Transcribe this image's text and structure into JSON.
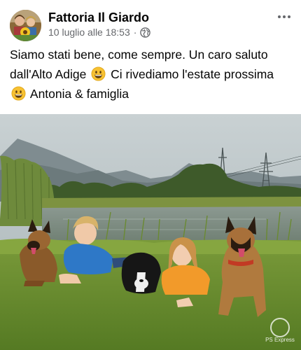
{
  "post": {
    "page_name": "Fattoria Il Giardo",
    "timestamp": "10 luglio alle 18:53",
    "separator": "·",
    "audience_icon": "globe-icon",
    "more_icon": "more-dots-icon",
    "text": {
      "line1": "Siamo stati bene, come sempre. Un caro saluto",
      "line2a": "dall'Alto Adige",
      "line2b": "Ci rivediamo l'estate prossima",
      "line3": "Antonia & famiglia"
    },
    "emoji_icon": "grinning-face-icon"
  },
  "photo": {
    "description_icon": "photo-family-dogs-lake",
    "watermark": "PS Express"
  },
  "colors": {
    "text_primary": "#050505",
    "text_secondary": "#65676b",
    "emoji_yellow": "#f7c132"
  }
}
